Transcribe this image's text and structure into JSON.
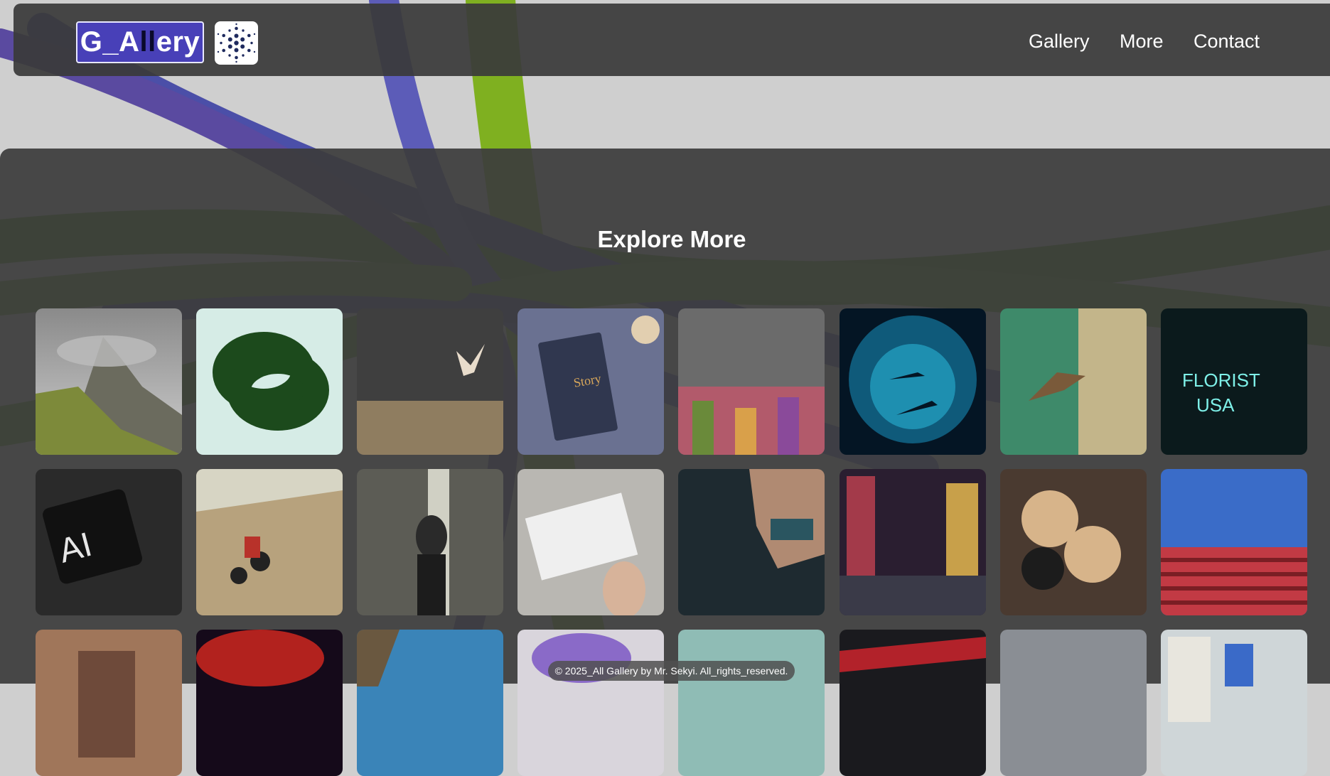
{
  "header": {
    "logo_text_light": "G_A",
    "logo_text_dark": "ll",
    "logo_text_tail": "ery",
    "logo_icon": "dotted-circle-icon",
    "nav": [
      {
        "label": "Gallery"
      },
      {
        "label": "More"
      },
      {
        "label": "Contact"
      }
    ]
  },
  "main": {
    "title": "Explore More",
    "gallery": [
      {
        "subject": "misty-mountain-peak"
      },
      {
        "subject": "green-grass-knot"
      },
      {
        "subject": "owl-flying-over-field"
      },
      {
        "subject": "journal-on-desk"
      },
      {
        "subject": "crowd-praying"
      },
      {
        "subject": "divers-underwater"
      },
      {
        "subject": "hummingbird"
      },
      {
        "subject": "neon-florist-sign"
      },
      {
        "subject": "ai-chip"
      },
      {
        "subject": "dirt-bike-rider"
      },
      {
        "subject": "woman-on-city-street"
      },
      {
        "subject": "hand-holding-card"
      },
      {
        "subject": "person-exercising"
      },
      {
        "subject": "neon-city-night"
      },
      {
        "subject": "coffee-cups"
      },
      {
        "subject": "red-building-blue-sky"
      },
      {
        "subject": "wooden-interior"
      },
      {
        "subject": "red-nebula"
      },
      {
        "subject": "rock-arch-sky"
      },
      {
        "subject": "purple-tree"
      },
      {
        "subject": "teal-water"
      },
      {
        "subject": "red-dark-abstract"
      },
      {
        "subject": "grey-sky"
      },
      {
        "subject": "white-buildings"
      }
    ]
  },
  "footer": {
    "text": "© 2025_All Gallery by Mr. Sekyi. All_rights_reserved."
  },
  "colors": {
    "panel": "#3c3c3c",
    "logo_bg": "#4840b8",
    "page_bg": "#cfcfcf"
  }
}
